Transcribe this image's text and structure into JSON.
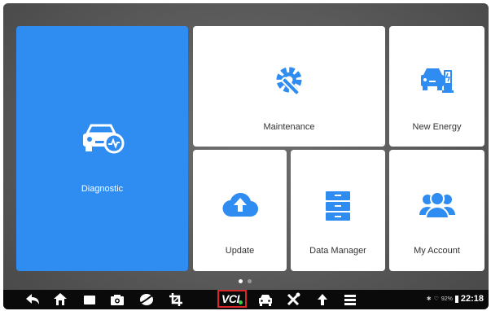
{
  "tiles": {
    "diagnostic": {
      "label": "Diagnostic",
      "icon": "car-diagnostic-icon",
      "color": "#2f8cf0"
    },
    "maintenance": {
      "label": "Maintenance",
      "icon": "wrench-gear-icon",
      "color": "#2f8cf0"
    },
    "new_energy": {
      "label": "New Energy",
      "icon": "ev-car-charger-icon",
      "color": "#2f8cf0"
    },
    "update": {
      "label": "Update",
      "icon": "cloud-upload-icon",
      "color": "#2f8cf0"
    },
    "data_manager": {
      "label": "Data Manager",
      "icon": "file-cabinet-icon",
      "color": "#2f8cf0"
    },
    "my_account": {
      "label": "My Account",
      "icon": "users-icon",
      "color": "#2f8cf0"
    }
  },
  "pager": {
    "pages": 2,
    "current": 1
  },
  "navbar": {
    "buttons": [
      "back-icon",
      "home-icon",
      "recent-apps-icon",
      "camera-icon",
      "browser-icon",
      "crop-icon",
      "vci-icon",
      "car-icon",
      "tools-icon",
      "upload-icon",
      "menu-icon"
    ],
    "vci_label": "VCI",
    "highlight_color": "#d9262c"
  },
  "status": {
    "battery": "92%",
    "time": "22:18"
  }
}
